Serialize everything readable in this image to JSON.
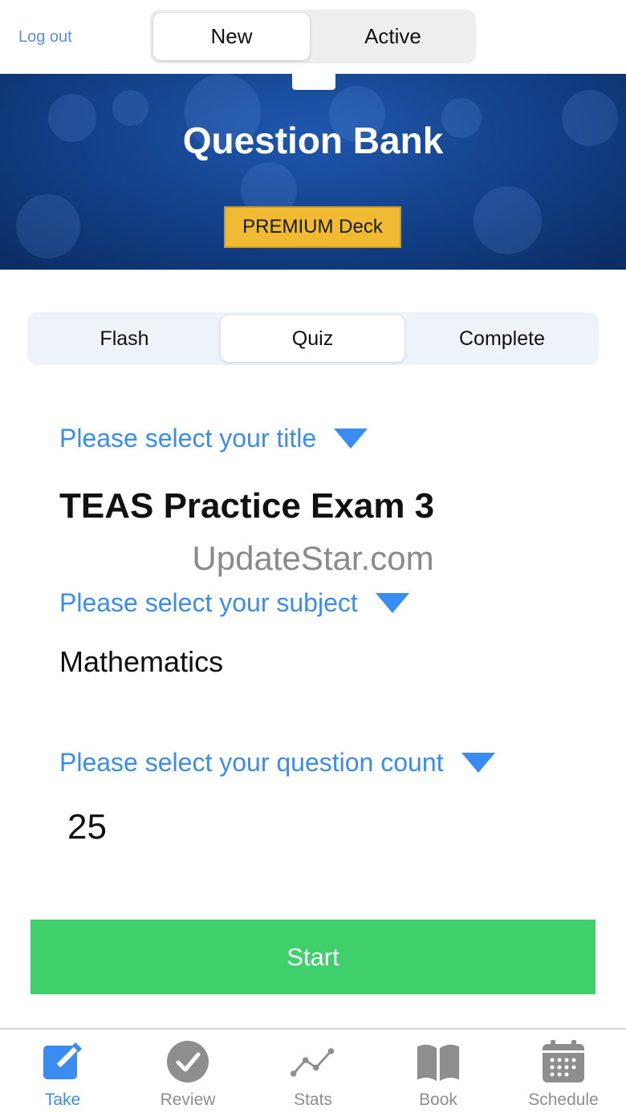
{
  "header": {
    "logout_label": "Log out",
    "segments": [
      {
        "label": "New",
        "selected": true
      },
      {
        "label": "Active",
        "selected": false
      }
    ]
  },
  "banner": {
    "title": "Question Bank",
    "badge": "PREMIUM Deck"
  },
  "mode_tabs": [
    {
      "label": "Flash",
      "selected": false
    },
    {
      "label": "Quiz",
      "selected": true
    },
    {
      "label": "Complete",
      "selected": false
    }
  ],
  "selectors": {
    "title": {
      "label": "Please select your title",
      "value": "TEAS Practice Exam 3"
    },
    "subject": {
      "label": "Please select your subject",
      "value": "Mathematics"
    },
    "count": {
      "label": "Please select your question count",
      "value": "25"
    }
  },
  "watermark": "UpdateStar.com",
  "start_label": "Start",
  "tabbar": [
    {
      "label": "Take",
      "icon": "pencil-square-icon",
      "selected": true
    },
    {
      "label": "Review",
      "icon": "check-circle-icon",
      "selected": false
    },
    {
      "label": "Stats",
      "icon": "line-stats-icon",
      "selected": false
    },
    {
      "label": "Book",
      "icon": "open-book-icon",
      "selected": false
    },
    {
      "label": "Schedule",
      "icon": "calendar-icon",
      "selected": false
    }
  ],
  "colors": {
    "accent": "#3b8cf0",
    "start_green": "#3fcf6b",
    "premium_gold": "#f0bb33",
    "banner_blue": "#123f86",
    "inactive_icon": "#8e8e8e"
  }
}
